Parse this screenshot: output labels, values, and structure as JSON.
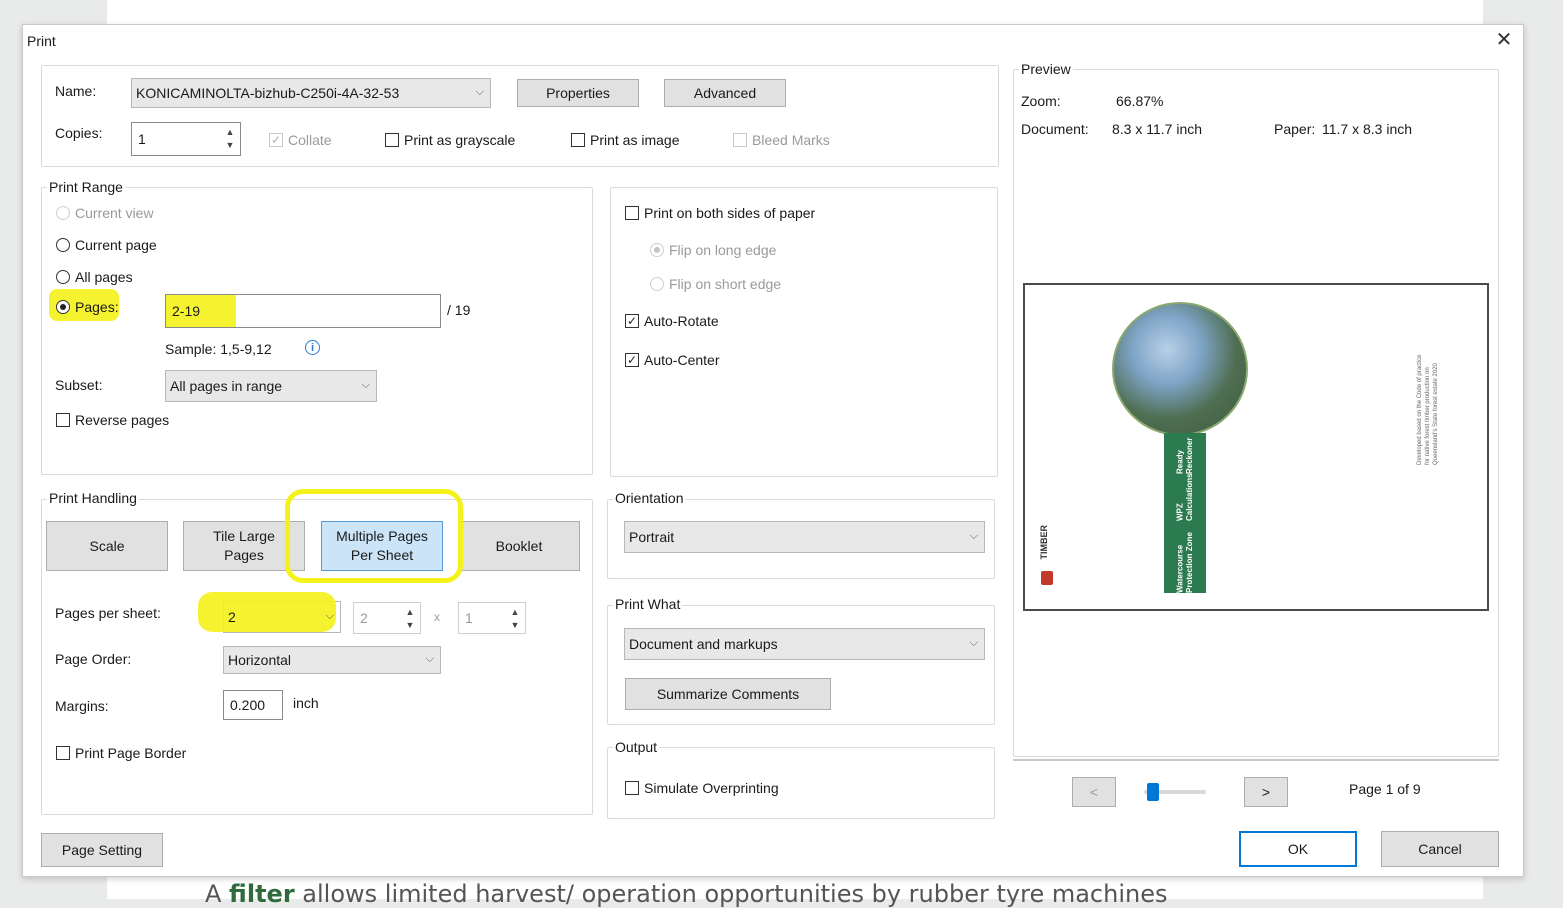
{
  "background": {
    "text_prefix": "A ",
    "text_bold": "filter",
    "text_rest": " allows limited harvest/ operation opportunities by rubber tyre machines"
  },
  "dialog": {
    "title": "Print",
    "close_icon": "close-icon"
  },
  "printer": {
    "name_label": "Name:",
    "name_value": "KONICAMINOLTA-bizhub-C250i-4A-32-53",
    "properties_label": "Properties",
    "advanced_label": "Advanced",
    "copies_label": "Copies:",
    "copies_value": "1",
    "collate_label": "Collate",
    "grayscale_label": "Print as grayscale",
    "image_label": "Print as image",
    "bleed_label": "Bleed Marks"
  },
  "range": {
    "title": "Print Range",
    "current_view": "Current view",
    "current_page": "Current page",
    "all_pages": "All pages",
    "pages_label": "Pages:",
    "pages_value": "2-19",
    "pages_total": "/ 19",
    "sample": "Sample: 1,5-9,12",
    "subset_label": "Subset:",
    "subset_value": "All pages in range",
    "reverse_label": "Reverse pages"
  },
  "duplex": {
    "both_sides": "Print on both sides of paper",
    "long_edge": "Flip on long edge",
    "short_edge": "Flip on short edge",
    "auto_rotate": "Auto-Rotate",
    "auto_center": "Auto-Center"
  },
  "handling": {
    "title": "Print Handling",
    "scale": "Scale",
    "tile_1": "Tile Large",
    "tile_2": "Pages",
    "multi_1": "Multiple Pages",
    "multi_2": "Per Sheet",
    "booklet": "Booklet",
    "pps_label": "Pages per sheet:",
    "pps_value": "2",
    "grid_cols": "2",
    "grid_x": "x",
    "grid_rows": "1",
    "order_label": "Page Order:",
    "order_value": "Horizontal",
    "margins_label": "Margins:",
    "margins_value": "0.200",
    "margins_unit": "inch",
    "border_label": "Print Page Border"
  },
  "orientation": {
    "title": "Orientation",
    "value": "Portrait"
  },
  "print_what": {
    "title": "Print What",
    "value": "Document and markups",
    "summarize": "Summarize Comments"
  },
  "output": {
    "title": "Output",
    "simulate": "Simulate Overprinting"
  },
  "preview": {
    "title": "Preview",
    "zoom_label": "Zoom:",
    "zoom_value": "66.87%",
    "document_label": "Document:",
    "document_value": "8.3 x 11.7 inch",
    "paper_label": "Paper:",
    "paper_value": "11.7 x 8.3 inch",
    "band_1": "Watercourse Protection Zone",
    "band_2": "WPZ Calculations",
    "band_3": "Ready Reckoner",
    "side_1": "Developed based on the Code of practice",
    "side_2": "for native forest timber production on",
    "side_3": "Queensland's State forest estate 2020",
    "logo": "TIMBER",
    "prev": "<",
    "next": ">",
    "page_status": "Page 1 of 9",
    "slider_fraction": 0.05
  },
  "footer": {
    "page_setting": "Page Setting",
    "ok": "OK",
    "cancel": "Cancel"
  },
  "colors": {
    "highlight": "#f4f21a",
    "selected_button": "#cce4f7",
    "ok_border": "#0078d7",
    "band_green": "#2c7a4f"
  }
}
